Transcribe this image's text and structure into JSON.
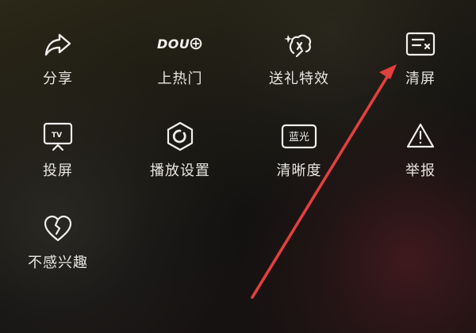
{
  "menu": {
    "row1": [
      {
        "label": "分享",
        "icon": "share-arrow-icon"
      },
      {
        "label": "上热门",
        "icon": "dou-plus-icon",
        "icon_text": "DOU"
      },
      {
        "label": "送礼特效",
        "icon": "gift-effect-icon"
      },
      {
        "label": "清屏",
        "icon": "clear-screen-icon"
      }
    ],
    "row2": [
      {
        "label": "投屏",
        "icon": "tv-cast-icon",
        "icon_text": "TV"
      },
      {
        "label": "播放设置",
        "icon": "hexagon-settings-icon"
      },
      {
        "label": "清晰度",
        "icon": "bluray-quality-icon",
        "icon_text": "蓝光"
      },
      {
        "label": "举报",
        "icon": "warning-triangle-icon"
      }
    ],
    "row3": [
      {
        "label": "不感兴趣",
        "icon": "broken-heart-icon"
      }
    ]
  },
  "annotation": {
    "type": "red-arrow",
    "color": "#e2403f",
    "points_to": "清屏"
  },
  "colors": {
    "icon": "#f2f0ed",
    "label": "#e9e6e2",
    "arrow": "#e2403f"
  }
}
